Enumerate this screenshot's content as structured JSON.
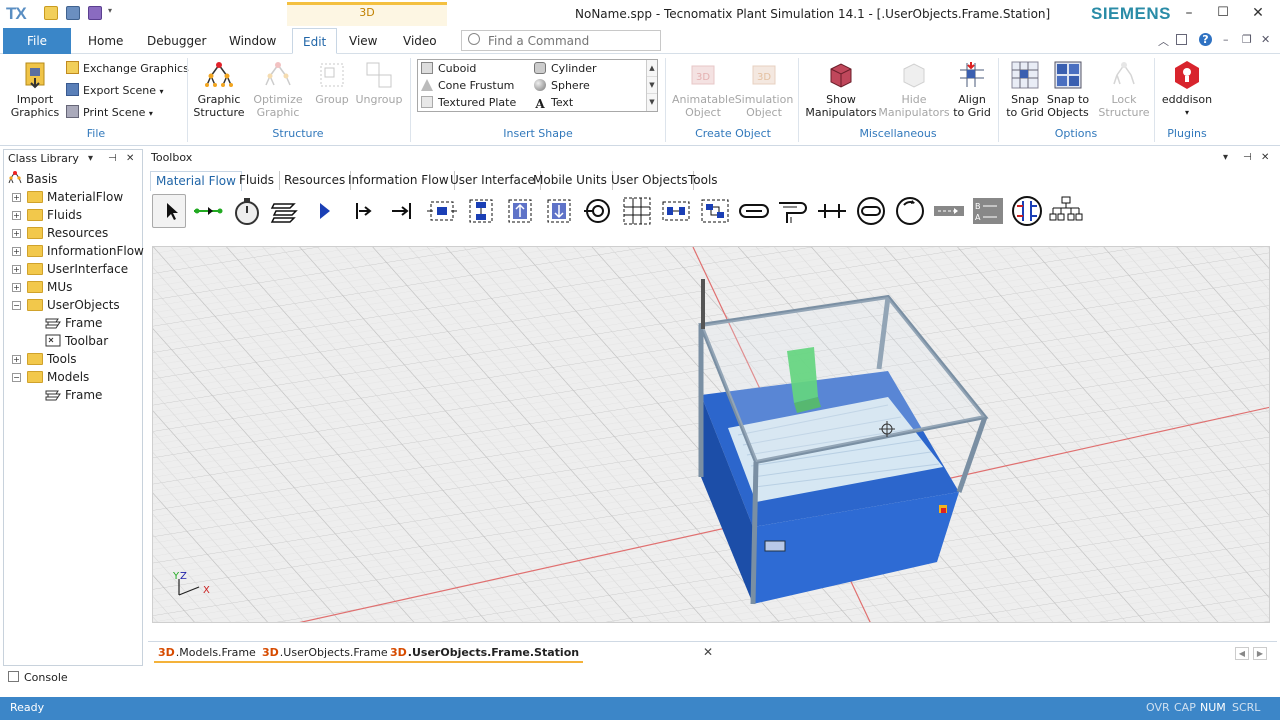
{
  "app": {
    "logo": "TX",
    "context_tab": "3D",
    "window_title": "NoName.spp - Tecnomatix Plant Simulation 14.1 - [.UserObjects.Frame.Station]",
    "brand": "SIEMENS"
  },
  "menu": {
    "file": "File",
    "tabs": [
      "Home",
      "Debugger",
      "Window",
      "Edit",
      "View",
      "Video"
    ],
    "find_placeholder": "Find a Command"
  },
  "ribbon": {
    "file_group": {
      "import": "Import\nGraphics",
      "exchange": "Exchange Graphics",
      "export": "Export Scene",
      "print": "Print Scene",
      "label": "File"
    },
    "structure_group": {
      "graphic_structure": "Graphic\nStructure",
      "optimize": "Optimize\nGraphic",
      "group": "Group",
      "ungroup": "Ungroup",
      "label": "Structure"
    },
    "insert_shape": {
      "items": [
        "Cuboid",
        "Cylinder",
        "Cone Frustum",
        "Sphere",
        "Textured Plate",
        "Text"
      ],
      "label": "Insert Shape"
    },
    "create_object": {
      "animatable": "Animatable\nObject",
      "simulation": "Simulation\nObject",
      "label": "Create Object"
    },
    "misc": {
      "show": "Show\nManipulators",
      "hide": "Hide\nManipulators",
      "align": "Align\nto Grid",
      "label": "Miscellaneous"
    },
    "options": {
      "snap_grid": "Snap\nto Grid",
      "snap_objects": "Snap to\nObjects",
      "lock": "Lock\nStructure",
      "label": "Options"
    },
    "plugins": {
      "edddison": "edddison",
      "label": "Plugins"
    }
  },
  "class_library": {
    "title": "Class Library",
    "items": [
      {
        "label": "Basis"
      },
      {
        "label": "MaterialFlow"
      },
      {
        "label": "Fluids"
      },
      {
        "label": "Resources"
      },
      {
        "label": "InformationFlow"
      },
      {
        "label": "UserInterface"
      },
      {
        "label": "MUs"
      },
      {
        "label": "UserObjects"
      },
      {
        "label": "Frame"
      },
      {
        "label": "Toolbar"
      },
      {
        "label": "Tools"
      },
      {
        "label": "Models"
      },
      {
        "label": "Frame"
      }
    ]
  },
  "toolbox": {
    "title": "Toolbox",
    "tabs": [
      "Material Flow",
      "Fluids",
      "Resources",
      "Information Flow",
      "User Interface",
      "Mobile Units",
      "User Objects",
      "Tools"
    ]
  },
  "doc_tabs": [
    {
      "prefix": "3D",
      "label": ".Models.Frame"
    },
    {
      "prefix": "3D",
      "label": ".UserObjects.Frame"
    },
    {
      "prefix": "3D",
      "label": ".UserObjects.Frame.Station"
    }
  ],
  "doc_close": "✕",
  "console": {
    "label": "Console"
  },
  "viewport": {
    "axis_y": "Y",
    "axis_z": "Z",
    "axis_x": "X"
  },
  "status": {
    "text": "Ready",
    "indicators": [
      "OVR",
      "CAP",
      "NUM",
      "SCRL"
    ],
    "active": "NUM"
  },
  "colors": {
    "accent": "#3a86c8",
    "brand": "#2a8ca7",
    "context": "#f4b23a",
    "station_blue": "#2f6fd0",
    "part_green": "#3ccf5a"
  }
}
